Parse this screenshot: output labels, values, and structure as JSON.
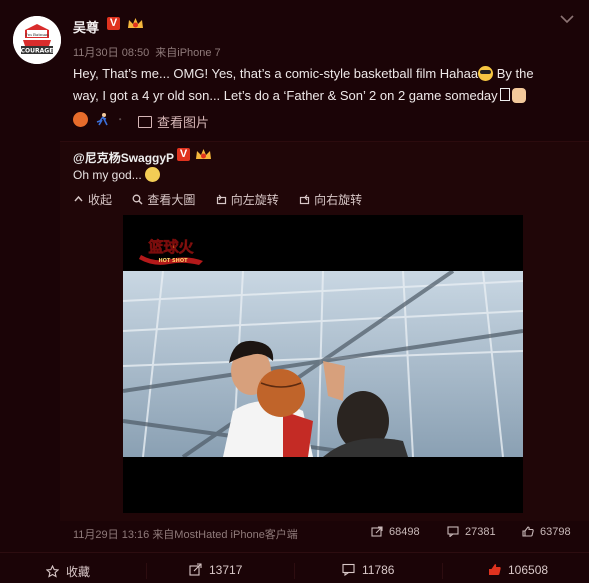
{
  "post": {
    "username": "吴尊",
    "verified_badge": "V",
    "time": "11月30日 08:50",
    "source": "来自iPhone 7",
    "text_lines": [
      "Hey, That’s me... OMG! Yes, that’s a comic-style basketball film Hahaa",
      " By the",
      "way, I got a 4 yr old son... Let’s do a ‘Father & Son’ 2 on 2 game someday"
    ],
    "view_image_label": "查看图片",
    "avatar_text": [
      "I'm Batman",
      "COURAGE"
    ]
  },
  "repost": {
    "username": "@尼克杨SwaggyP",
    "verified_badge": "V",
    "text": "Oh my god...",
    "toolbar": {
      "collapse": "收起",
      "view_large": "查看大圖",
      "rotate_left": "向左旋转",
      "rotate_right": "向右旋转"
    },
    "video_logo": "篮球火",
    "video_logo_sub": "HOT SHOT",
    "time": "11月29日 13:16",
    "source": "来自MostHated iPhone客户端",
    "stats": {
      "reposts": "68498",
      "comments": "27381",
      "likes": "63798"
    }
  },
  "actions": {
    "favorite": "收藏",
    "repost": "13717",
    "comment": "11786",
    "like": "106508"
  },
  "colors": {
    "background": "#1b0407",
    "verified": "#e0331f",
    "meta": "#8f7a7a"
  }
}
